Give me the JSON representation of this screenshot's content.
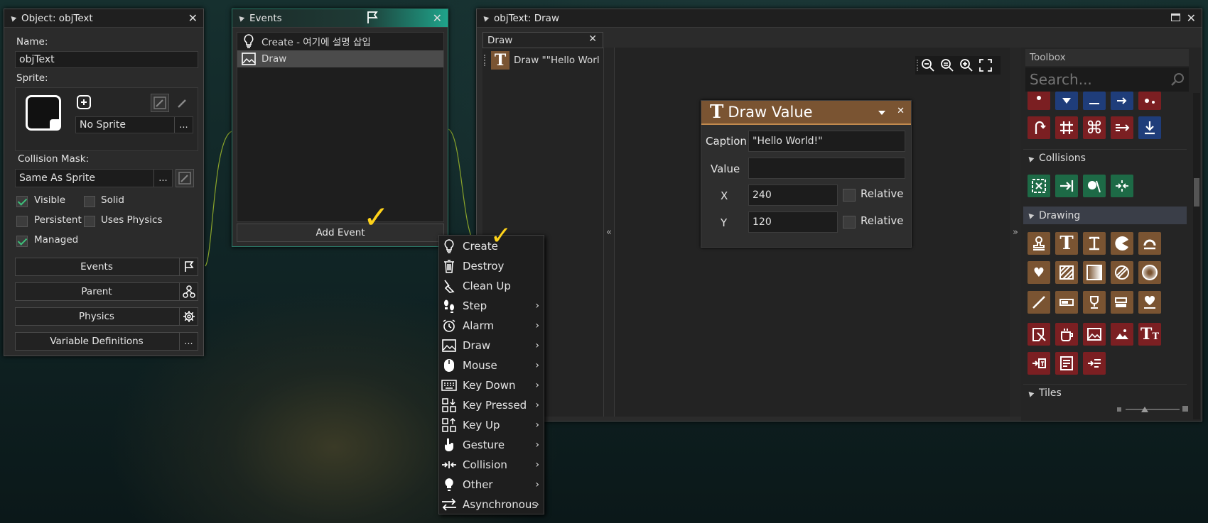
{
  "object_window": {
    "title": "Object: objText",
    "name_label": "Name:",
    "name_value": "objText",
    "sprite_label": "Sprite:",
    "sprite_value": "No Sprite",
    "collision_mask_label": "Collision Mask:",
    "collision_mask_value": "Same As Sprite",
    "checkboxes": [
      {
        "label": "Visible",
        "checked": true
      },
      {
        "label": "Solid",
        "checked": false
      },
      {
        "label": "Persistent",
        "checked": false
      },
      {
        "label": "Uses Physics",
        "checked": false
      },
      {
        "label": "Managed",
        "checked": true
      }
    ],
    "buttons": {
      "events": "Events",
      "parent": "Parent",
      "physics": "Physics",
      "variable_definitions": "Variable Definitions"
    },
    "dots": "..."
  },
  "events_window": {
    "title": "Events",
    "events": [
      {
        "label": "Create - 여기에 설명 삽입",
        "icon": "lightbulb-icon"
      },
      {
        "label": "Draw",
        "icon": "image-icon",
        "selected": true
      }
    ],
    "add_event": "Add Event"
  },
  "event_menu": {
    "items": [
      {
        "label": "Create",
        "icon": "lightbulb-icon",
        "submenu": false
      },
      {
        "label": "Destroy",
        "icon": "trash-icon",
        "submenu": false
      },
      {
        "label": "Clean Up",
        "icon": "broom-icon",
        "submenu": false
      },
      {
        "label": "Step",
        "icon": "footsteps-icon",
        "submenu": true
      },
      {
        "label": "Alarm",
        "icon": "alarm-clock-icon",
        "submenu": true
      },
      {
        "label": "Draw",
        "icon": "image-icon",
        "submenu": true
      },
      {
        "label": "Mouse",
        "icon": "mouse-icon",
        "submenu": true
      },
      {
        "label": "Key Down",
        "icon": "keyboard-icon",
        "submenu": true
      },
      {
        "label": "Key Pressed",
        "icon": "key-pressed-icon",
        "submenu": true
      },
      {
        "label": "Key Up",
        "icon": "key-up-icon",
        "submenu": true
      },
      {
        "label": "Gesture",
        "icon": "hand-pointer-icon",
        "submenu": true
      },
      {
        "label": "Collision",
        "icon": "collision-arrows-icon",
        "submenu": true
      },
      {
        "label": "Other",
        "icon": "bulb-icon",
        "submenu": true
      },
      {
        "label": "Asynchronous",
        "icon": "swap-arrows-icon",
        "submenu": true
      }
    ]
  },
  "draw_window": {
    "title": "objText: Draw",
    "tab": "Draw",
    "action_list_item": "Draw \"\"Hello World",
    "collapse_left": "«",
    "collapse_right": "»",
    "draw_value": {
      "title": "Draw Value",
      "caption_label": "Caption",
      "caption_value": "\"Hello World!\"",
      "value_label": "Value",
      "value_value": "",
      "x_label": "X",
      "x_value": "240",
      "y_label": "Y",
      "y_value": "120",
      "relative_label": "Relative"
    },
    "toolbox": {
      "title": "Toolbox",
      "search_placeholder": "Search...",
      "sections": [
        "Collisions",
        "Drawing",
        "Tiles"
      ]
    }
  },
  "colors": {
    "accent_teal": "#1fa38a",
    "draw_value_header": "#7a5432",
    "check_mark": "#ffd31a"
  }
}
